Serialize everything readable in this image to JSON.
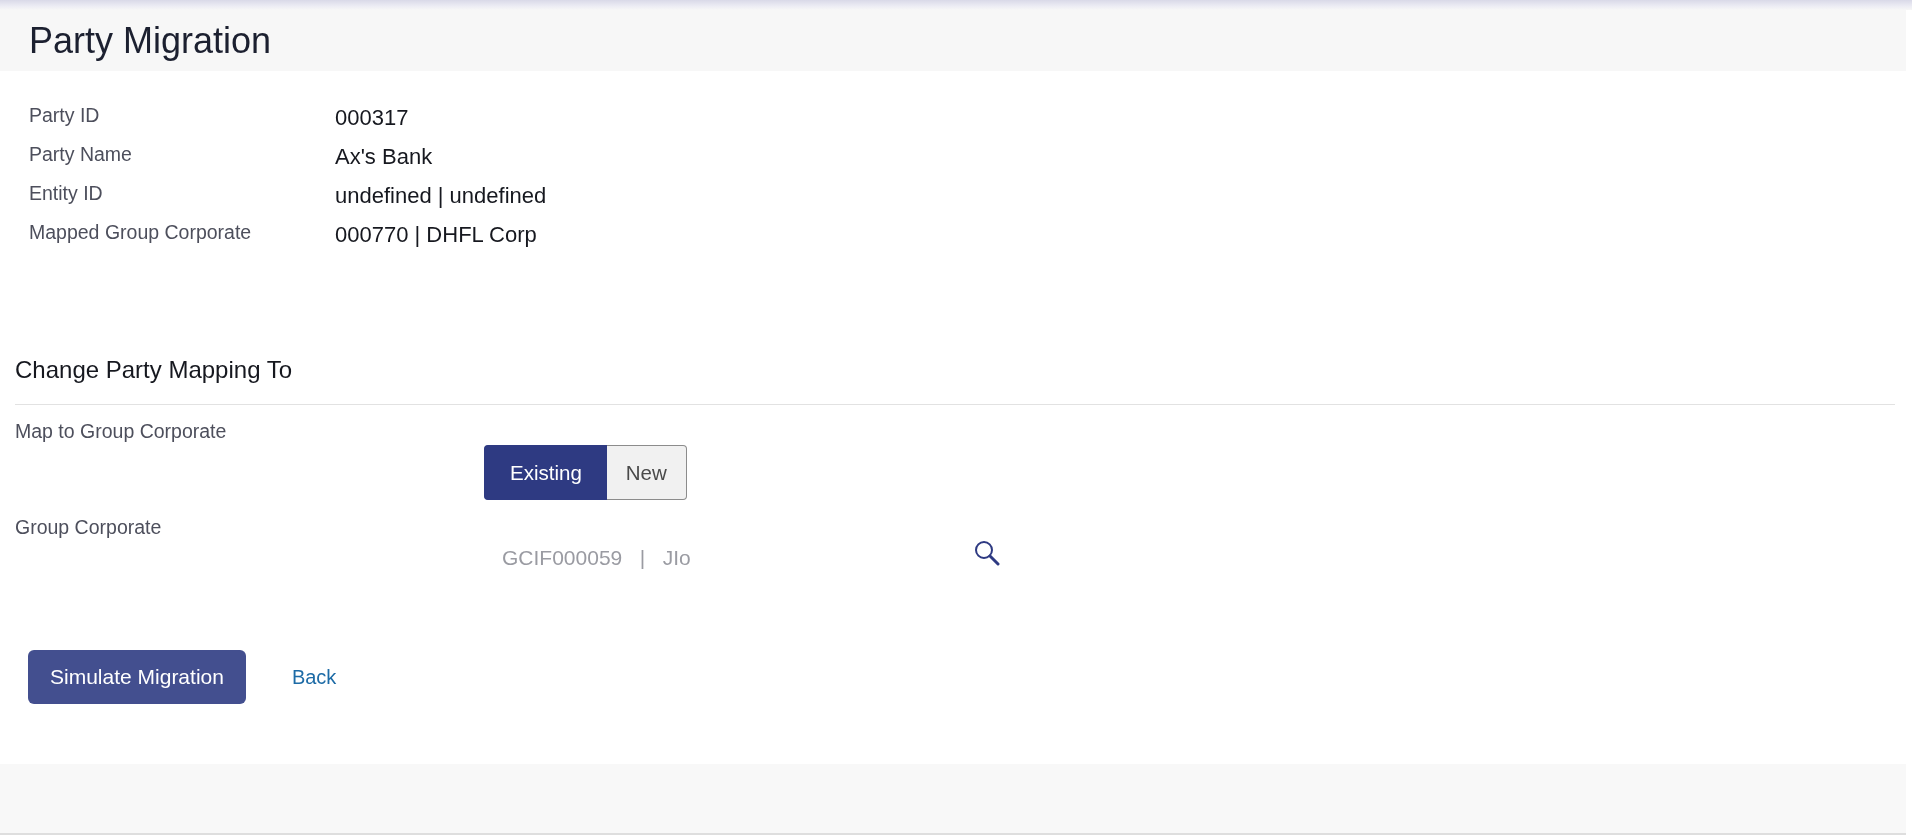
{
  "header": {
    "title": "Party Migration"
  },
  "details": [
    {
      "label": "Party ID",
      "value": "000317"
    },
    {
      "label": "Party Name",
      "value": "Ax's Bank"
    },
    {
      "label": "Entity ID",
      "value": "undefined | undefined"
    },
    {
      "label": "Mapped Group Corporate",
      "value": "000770 | DHFL Corp"
    }
  ],
  "mapping": {
    "title": "Change Party Mapping To",
    "fields": [
      {
        "kind": "toggle",
        "label": "Map to Group Corporate",
        "options": [
          {
            "label": "Existing",
            "selected": true
          },
          {
            "label": "New",
            "selected": false
          }
        ]
      },
      {
        "kind": "lookup",
        "label": "Group Corporate",
        "value": "GCIF000059   |   JIo"
      }
    ]
  },
  "actions": [
    {
      "kind": "primary",
      "label": "Simulate Migration"
    },
    {
      "kind": "link",
      "label": "Back"
    }
  ]
}
